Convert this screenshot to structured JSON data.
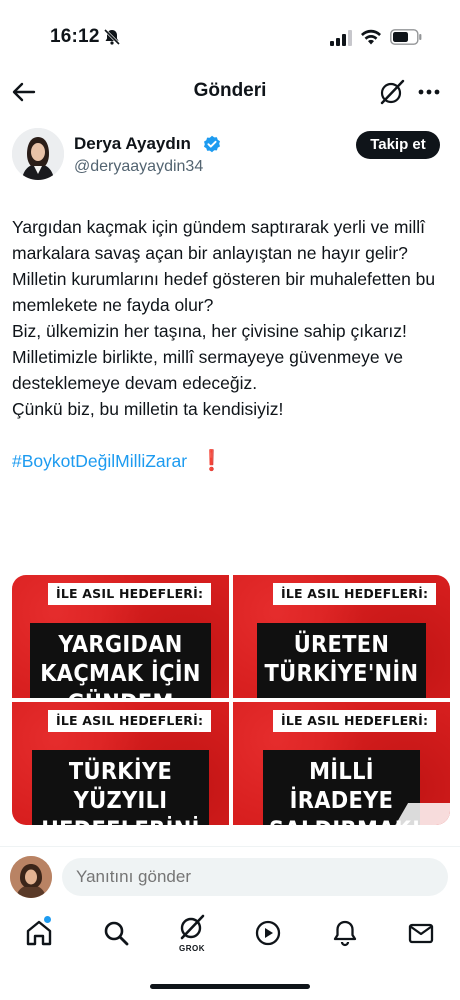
{
  "status_bar": {
    "time": "16:12",
    "icons": [
      "bell-slash-icon",
      "signal-icon",
      "wifi-icon",
      "battery-icon"
    ]
  },
  "nav": {
    "title": "Gönderi",
    "icons": [
      "back-arrow-icon",
      "grok-icon",
      "more-icon"
    ]
  },
  "author": {
    "name": "Derya Ayaydın",
    "handle": "@deryaayaydin34",
    "verified": true,
    "follow_label": "Takip et"
  },
  "tweet": {
    "lines": [
      "Yargıdan kaçmak için gündem saptırarak yerli ve millî markalara savaş açan bir anlayıştan ne hayır gelir?",
      "Milletin kurumlarını hedef gösteren bir muhalefetten bu memlekete ne fayda olur?",
      "Biz, ülkemizin her taşına, her çivisine sahip çıkarız!",
      "Milletimizle birlikte, millî sermayeye güvenmeye ve desteklemeye devam edeceğiz.",
      "Çünkü biz, bu milletin ta kendisiyiz!"
    ],
    "hashtag": "#BoykotDeğilMilliZarar",
    "emoji": "❗"
  },
  "media": [
    {
      "label": "İLE ASIL HEDEFLERİ:",
      "headline": "YARGIDAN KAÇMAK İÇİN GÜNDEM"
    },
    {
      "label": "İLE ASIL HEDEFLERİ:",
      "headline": "ÜRETEN TÜRKİYE'NİN"
    },
    {
      "label": "İLE ASIL HEDEFLERİ:",
      "headline": "TÜRKİYE YÜZYILI HEDEFLERİNİ"
    },
    {
      "label": "İLE ASIL HEDEFLERİ:",
      "headline": "MİLLİ İRADEYE SALDIRMAK!"
    }
  ],
  "reply": {
    "placeholder": "Yanıtını gönder"
  },
  "tabs": {
    "items": [
      "home-icon",
      "search-icon",
      "grok-icon",
      "video-icon",
      "notifications-icon",
      "messages-icon"
    ],
    "grok_label": "GROK"
  },
  "colors": {
    "accent": "#1d9bf0",
    "text": "#0f1419",
    "secondary": "#536471",
    "media_red": "#d81f1f",
    "emoji_red": "#e0202b"
  }
}
